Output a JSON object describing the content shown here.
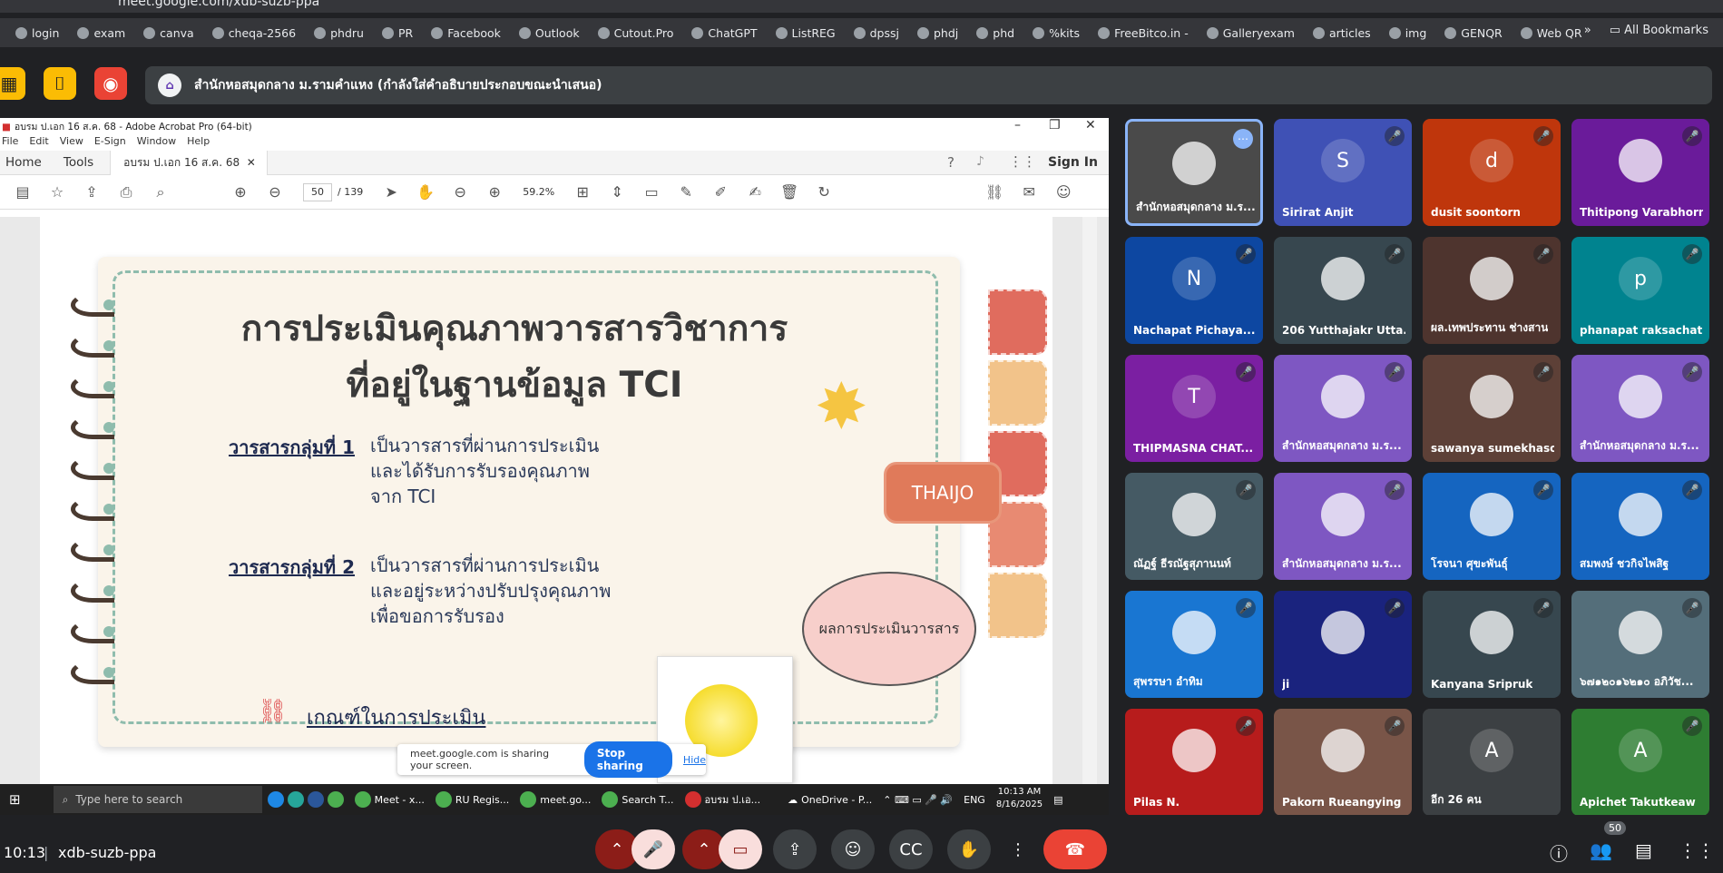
{
  "browser": {
    "url": "meet.google.com/xdb-suzb-ppa",
    "bookmarks": [
      "login",
      "exam",
      "canva",
      "cheqa-2566",
      "phdru",
      "PR",
      "Facebook",
      "Outlook",
      "Cutout.Pro",
      "ChatGPT",
      "ListREG",
      "dpssj",
      "phdj",
      "phd",
      "%kits",
      "FreeBitco.in -",
      "Galleryexam",
      "articles",
      "img",
      "GENQR",
      "Web QR"
    ],
    "all_bookmarks": "All Bookmarks"
  },
  "presenter_banner": "สำนักหอสมุดกลาง ม.รามคำแหง (กำลังใส่คำอธิบายประกอบขณะนำเสนอ)",
  "acrobat": {
    "title": "อบรม ป.เอก 16 ส.ค. 68 - Adobe Acrobat Pro (64-bit)",
    "menu": [
      "File",
      "Edit",
      "View",
      "E-Sign",
      "Window",
      "Help"
    ],
    "tabs": {
      "home": "Home",
      "tools": "Tools",
      "doc": "อบรม ป.เอก 16 ส.ค. 68",
      "sign_in": "Sign In"
    },
    "page_current": "50",
    "page_total": "/ 139",
    "zoom": "59.2%"
  },
  "slide": {
    "title1": "การประเมินคุณภาพวารสารวิชาการ",
    "title2": "ที่อยู่ในฐานข้อมูล TCI",
    "group1": "วารสารกลุ่มที่ 1",
    "group1_desc": [
      "เป็นวารสารที่ผ่านการประเมิน",
      "และได้รับการรับรองคุณภาพ",
      "จาก TCI"
    ],
    "group2": "วารสารกลุ่มที่ 2",
    "group2_desc": [
      "เป็นวารสารที่ผ่านการประเมิน",
      "และอยู่ระหว่างปรับปรุงคุณภาพ",
      "เพื่อขอการรับรอง"
    ],
    "criteria": "เกณฑ์ในการประเมิน",
    "thaijo": "THAIJO",
    "bubble": "ผลการประเมินวารสาร"
  },
  "share_notice": {
    "text": "meet.google.com is sharing your screen.",
    "stop": "Stop sharing",
    "hide": "Hide"
  },
  "taskbar": {
    "search": "Type here to search",
    "apps": [
      "Meet - x...",
      "RU Regis...",
      "meet.go...",
      "Search T...",
      "อบรม ป.เอ..."
    ],
    "onedrive": "OneDrive - P...",
    "lang": "ENG",
    "time": "10:13 AM",
    "date": "8/16/2025"
  },
  "participants": [
    {
      "name": "สำนักหอสมุดกลาง ม.ร...",
      "letter": "",
      "color": "#4a4a4a"
    },
    {
      "name": "Sirirat Anjit",
      "letter": "S",
      "color": "#3f51b5"
    },
    {
      "name": "dusit soontorn",
      "letter": "d",
      "color": "#bf360c"
    },
    {
      "name": "Thitipong Varabhorn",
      "letter": "",
      "color": "#6a1b9a"
    },
    {
      "name": "Nachapat Pichaya...",
      "letter": "N",
      "color": "#0d47a1"
    },
    {
      "name": "206 Yutthajakr Utta...",
      "letter": "",
      "color": "#37474f"
    },
    {
      "name": "ผล.เทพประทาน ช่างสาน",
      "letter": "",
      "color": "#4e342e"
    },
    {
      "name": "phanapat raksachat",
      "letter": "p",
      "color": "#00838f"
    },
    {
      "name": "THIPMASNA CHAT...",
      "letter": "T",
      "color": "#7b1fa2"
    },
    {
      "name": "สำนักหอสมุดกลาง ม.ร...",
      "letter": "",
      "color": "#7e57c2"
    },
    {
      "name": "sawanya sumekhaso",
      "letter": "",
      "color": "#5d4037"
    },
    {
      "name": "สำนักหอสมุดกลาง ม.ร...",
      "letter": "",
      "color": "#7e57c2"
    },
    {
      "name": "ณัฏฐ์ ธีรณัฐสุภานนท์",
      "letter": "",
      "color": "#455a64"
    },
    {
      "name": "สำนักหอสมุดกลาง ม.ร...",
      "letter": "",
      "color": "#7e57c2"
    },
    {
      "name": "โรจนา ศุขะพันธุ์",
      "letter": "",
      "color": "#1565c0"
    },
    {
      "name": "สมพงษ์ ชวกิจไพสิฐ",
      "letter": "",
      "color": "#1565c0"
    },
    {
      "name": "สุพรรษา อำทิม",
      "letter": "",
      "color": "#1976d2"
    },
    {
      "name": "ji",
      "letter": "",
      "color": "#1a237e"
    },
    {
      "name": "Kanyana Sripruk",
      "letter": "",
      "color": "#37474f"
    },
    {
      "name": "๖๗๑๒๐๑๖๒๑๐ อภิวัช...",
      "letter": "",
      "color": "#546e7a"
    },
    {
      "name": "Pilas N.",
      "letter": "",
      "color": "#b71c1c"
    },
    {
      "name": "Pakorn Rueangying",
      "letter": "",
      "color": "#795548"
    },
    {
      "name": "อีก 26 คน",
      "letter": "A",
      "color": "#3c4043"
    },
    {
      "name": "Apichet Takutkeaw",
      "letter": "A",
      "color": "#2e7d32"
    }
  ],
  "bottom": {
    "time": "10:13",
    "code": "xdb-suzb-ppa",
    "people_count": "50"
  }
}
